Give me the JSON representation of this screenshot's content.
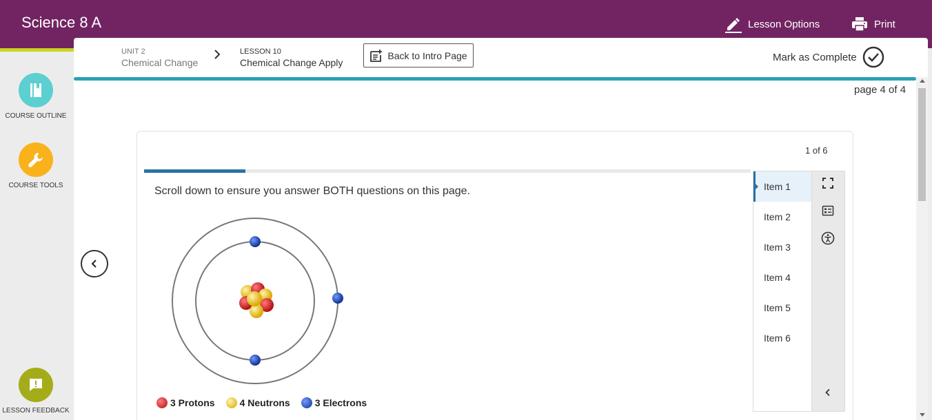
{
  "app": {
    "title": "Science 8 A",
    "lesson_options_label": "Lesson Options",
    "print_label": "Print"
  },
  "sidebar": {
    "items": [
      {
        "label": "COURSE OUTLINE",
        "icon": "book-icon",
        "color": "#5ccfd0"
      },
      {
        "label": "COURSE TOOLS",
        "icon": "wrench-icon",
        "color": "#f9b21b"
      },
      {
        "label": "LESSON FEEDBACK",
        "icon": "feedback-icon",
        "color": "#a4ac1a"
      }
    ]
  },
  "header": {
    "unit_label": "UNIT 2",
    "unit_title": "Chemical Change",
    "lesson_label": "LESSON 10",
    "lesson_title": "Chemical Change Apply",
    "back_button_label": "Back to Intro Page",
    "mark_complete_label": "Mark as Complete",
    "page_indicator": "page 4 of 4"
  },
  "activity": {
    "counter": "1 of 6",
    "progress_fraction": 0.1667,
    "instructions": "Scroll down to ensure you answer BOTH questions on this page.",
    "legend": [
      {
        "label": "3 Protons",
        "color": "#d42a2a"
      },
      {
        "label": "4 Neutrons",
        "color": "#f1c816"
      },
      {
        "label": "3 Electrons",
        "color": "#1f4fc9"
      }
    ],
    "items": [
      "Item 1",
      "Item 2",
      "Item 3",
      "Item 4",
      "Item 5",
      "Item 6"
    ],
    "active_item_index": 0
  },
  "colors": {
    "brand": "#722462",
    "accent": "#cbd31e",
    "progress": "#2ba0b5",
    "item_progress": "#2a73a3"
  }
}
